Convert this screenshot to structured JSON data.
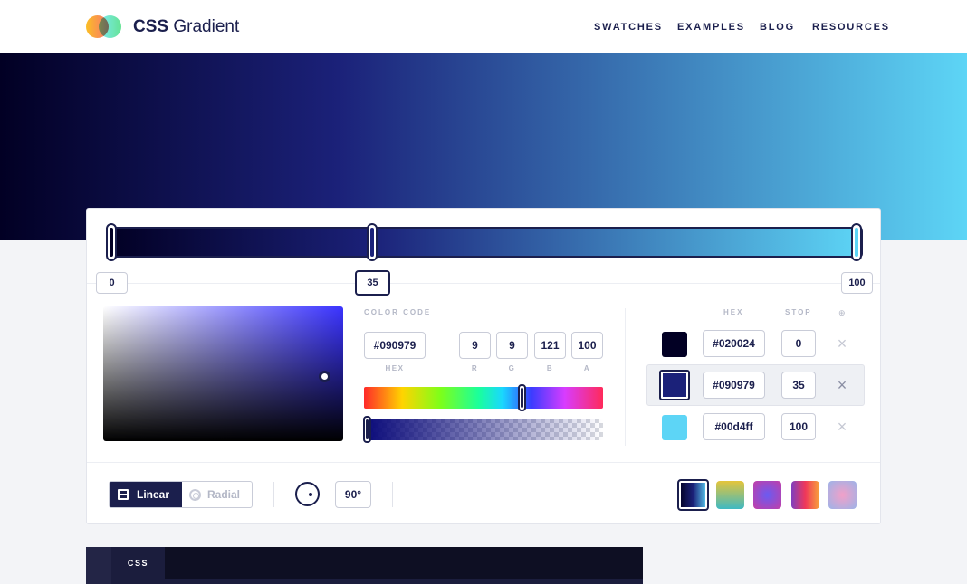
{
  "header": {
    "brand_bold": "CSS",
    "brand_light": " Gradient",
    "nav": [
      "SWATCHES",
      "EXAMPLES",
      "BLOG",
      "RESOURCES"
    ]
  },
  "gradient": {
    "stops": [
      {
        "hex": "#020024",
        "stop": "0",
        "color": "#020024",
        "remove": "×"
      },
      {
        "hex": "#090979",
        "stop": "35",
        "color": "#1b2179",
        "remove": "×"
      },
      {
        "hex": "#00d4ff",
        "stop": "100",
        "color": "#5dd5f6",
        "remove": "×"
      }
    ],
    "active_stop_index": 1
  },
  "stop_labels": [
    "0",
    "35",
    "100"
  ],
  "color_code": {
    "section_label": "COLOR CODE",
    "hex": "#090979",
    "r": "9",
    "g": "9",
    "b": "121",
    "a": "100",
    "sub_labels": {
      "hex": "HEX",
      "r": "R",
      "g": "G",
      "b": "B",
      "a": "A"
    },
    "hue_level": 0.66,
    "alpha_level": 1.0
  },
  "stops_table": {
    "hex_label": "HEX",
    "stop_label": "STOP",
    "add_icon": "⊕"
  },
  "type_toggle": {
    "linear_label": "Linear",
    "radial_label": "Radial",
    "selected": "Linear"
  },
  "angle": {
    "value": "90°"
  },
  "presets": [
    {
      "name": "preset-navy-cyan",
      "gradient": "linear-gradient(90deg,#020024,#1b2179,#5dd5f6)"
    },
    {
      "name": "preset-yellow-teal",
      "gradient": "linear-gradient(180deg,#e5c53a,#3fb9c2)"
    },
    {
      "name": "preset-purple-pink",
      "gradient": "radial-gradient(circle,#6a5bf2,#c43ea6)"
    },
    {
      "name": "preset-purple-orange",
      "gradient": "linear-gradient(90deg,#7f3fbf,#f0375a,#f8a33a)"
    },
    {
      "name": "preset-blue-pink",
      "gradient": "radial-gradient(circle,#f2a0c8,#9db3e8)"
    }
  ],
  "code_panel": {
    "tab_label": "CSS"
  },
  "colors": {
    "accent": "#1b1f4d",
    "border": "#c9ccd8"
  }
}
